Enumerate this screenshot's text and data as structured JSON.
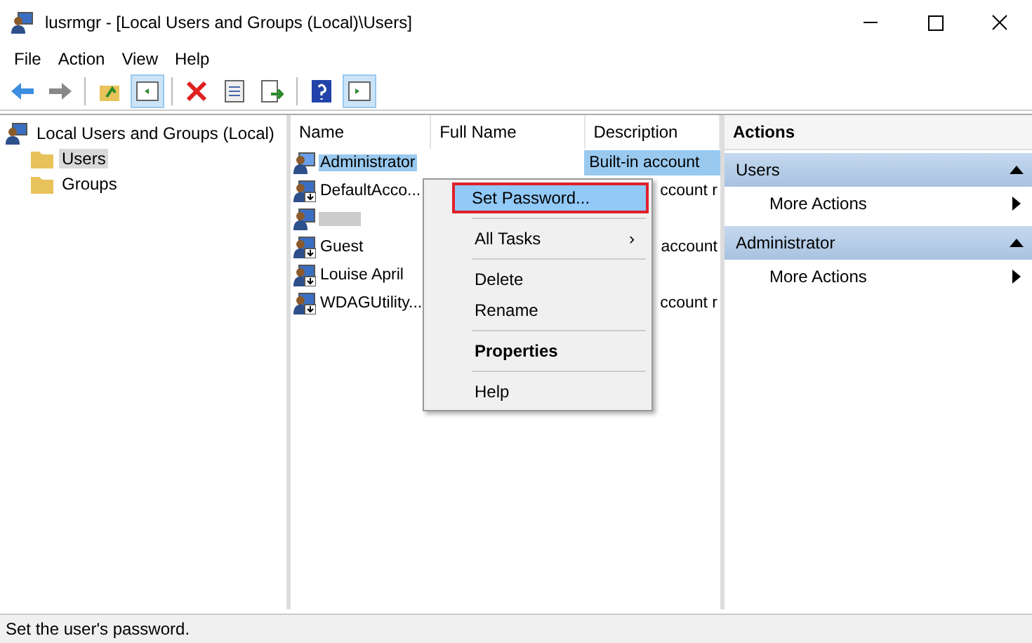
{
  "window": {
    "title": "lusrmgr - [Local Users and Groups (Local)\\Users]"
  },
  "menu": [
    "File",
    "Action",
    "View",
    "Help"
  ],
  "toolbar": [
    {
      "kind": "back"
    },
    {
      "kind": "forward"
    },
    {
      "kind": "sep"
    },
    {
      "kind": "up"
    },
    {
      "kind": "tree",
      "selected": true
    },
    {
      "kind": "sep"
    },
    {
      "kind": "delete"
    },
    {
      "kind": "props"
    },
    {
      "kind": "export"
    },
    {
      "kind": "sep"
    },
    {
      "kind": "help"
    },
    {
      "kind": "pane",
      "selected": true
    }
  ],
  "tree": {
    "label": "Local Users and Groups (Local)",
    "children": [
      {
        "label": "Users",
        "selected": true
      },
      {
        "label": "Groups",
        "selected": false
      }
    ]
  },
  "table": {
    "columns": [
      "Name",
      "Full Name",
      "Description"
    ],
    "rows": [
      {
        "kind": "admin",
        "name": "Administrator",
        "full_name": "",
        "description": "Built-in account",
        "covered": false,
        "selected": true
      },
      {
        "kind": "user",
        "name": "DefaultAcco...",
        "description": "ccount r",
        "covered": true,
        "selected": false
      },
      {
        "kind": "redacted",
        "selected": false
      },
      {
        "kind": "user",
        "name": "Guest",
        "description": "account",
        "covered": true,
        "selected": false
      },
      {
        "kind": "user",
        "name": "Louise April",
        "selected": false
      },
      {
        "kind": "user",
        "name": "WDAGUtility...",
        "description": "ccount r",
        "covered": true,
        "selected": false
      }
    ]
  },
  "context_menu": [
    {
      "kind": "item",
      "label": "Set Password...",
      "selected": true,
      "bold": false
    },
    {
      "kind": "sep"
    },
    {
      "kind": "submenu",
      "label": "All Tasks",
      "arrow": "›",
      "selected": false,
      "bold": false
    },
    {
      "kind": "sep"
    },
    {
      "kind": "item",
      "label": "Delete",
      "selected": false,
      "bold": false
    },
    {
      "kind": "item",
      "label": "Rename",
      "selected": false,
      "bold": false
    },
    {
      "kind": "sep"
    },
    {
      "kind": "item",
      "label": "Properties",
      "selected": false,
      "bold": true
    },
    {
      "kind": "sep"
    },
    {
      "kind": "item",
      "label": "Help",
      "selected": false,
      "bold": false
    }
  ],
  "actions": {
    "title": "Actions",
    "groups": [
      {
        "label": "Users",
        "expanded": true,
        "items": [
          "More Actions"
        ]
      },
      {
        "label": "Administrator",
        "expanded": true,
        "items": [
          "More Actions"
        ]
      }
    ]
  },
  "status_bar": "Set the user's password."
}
